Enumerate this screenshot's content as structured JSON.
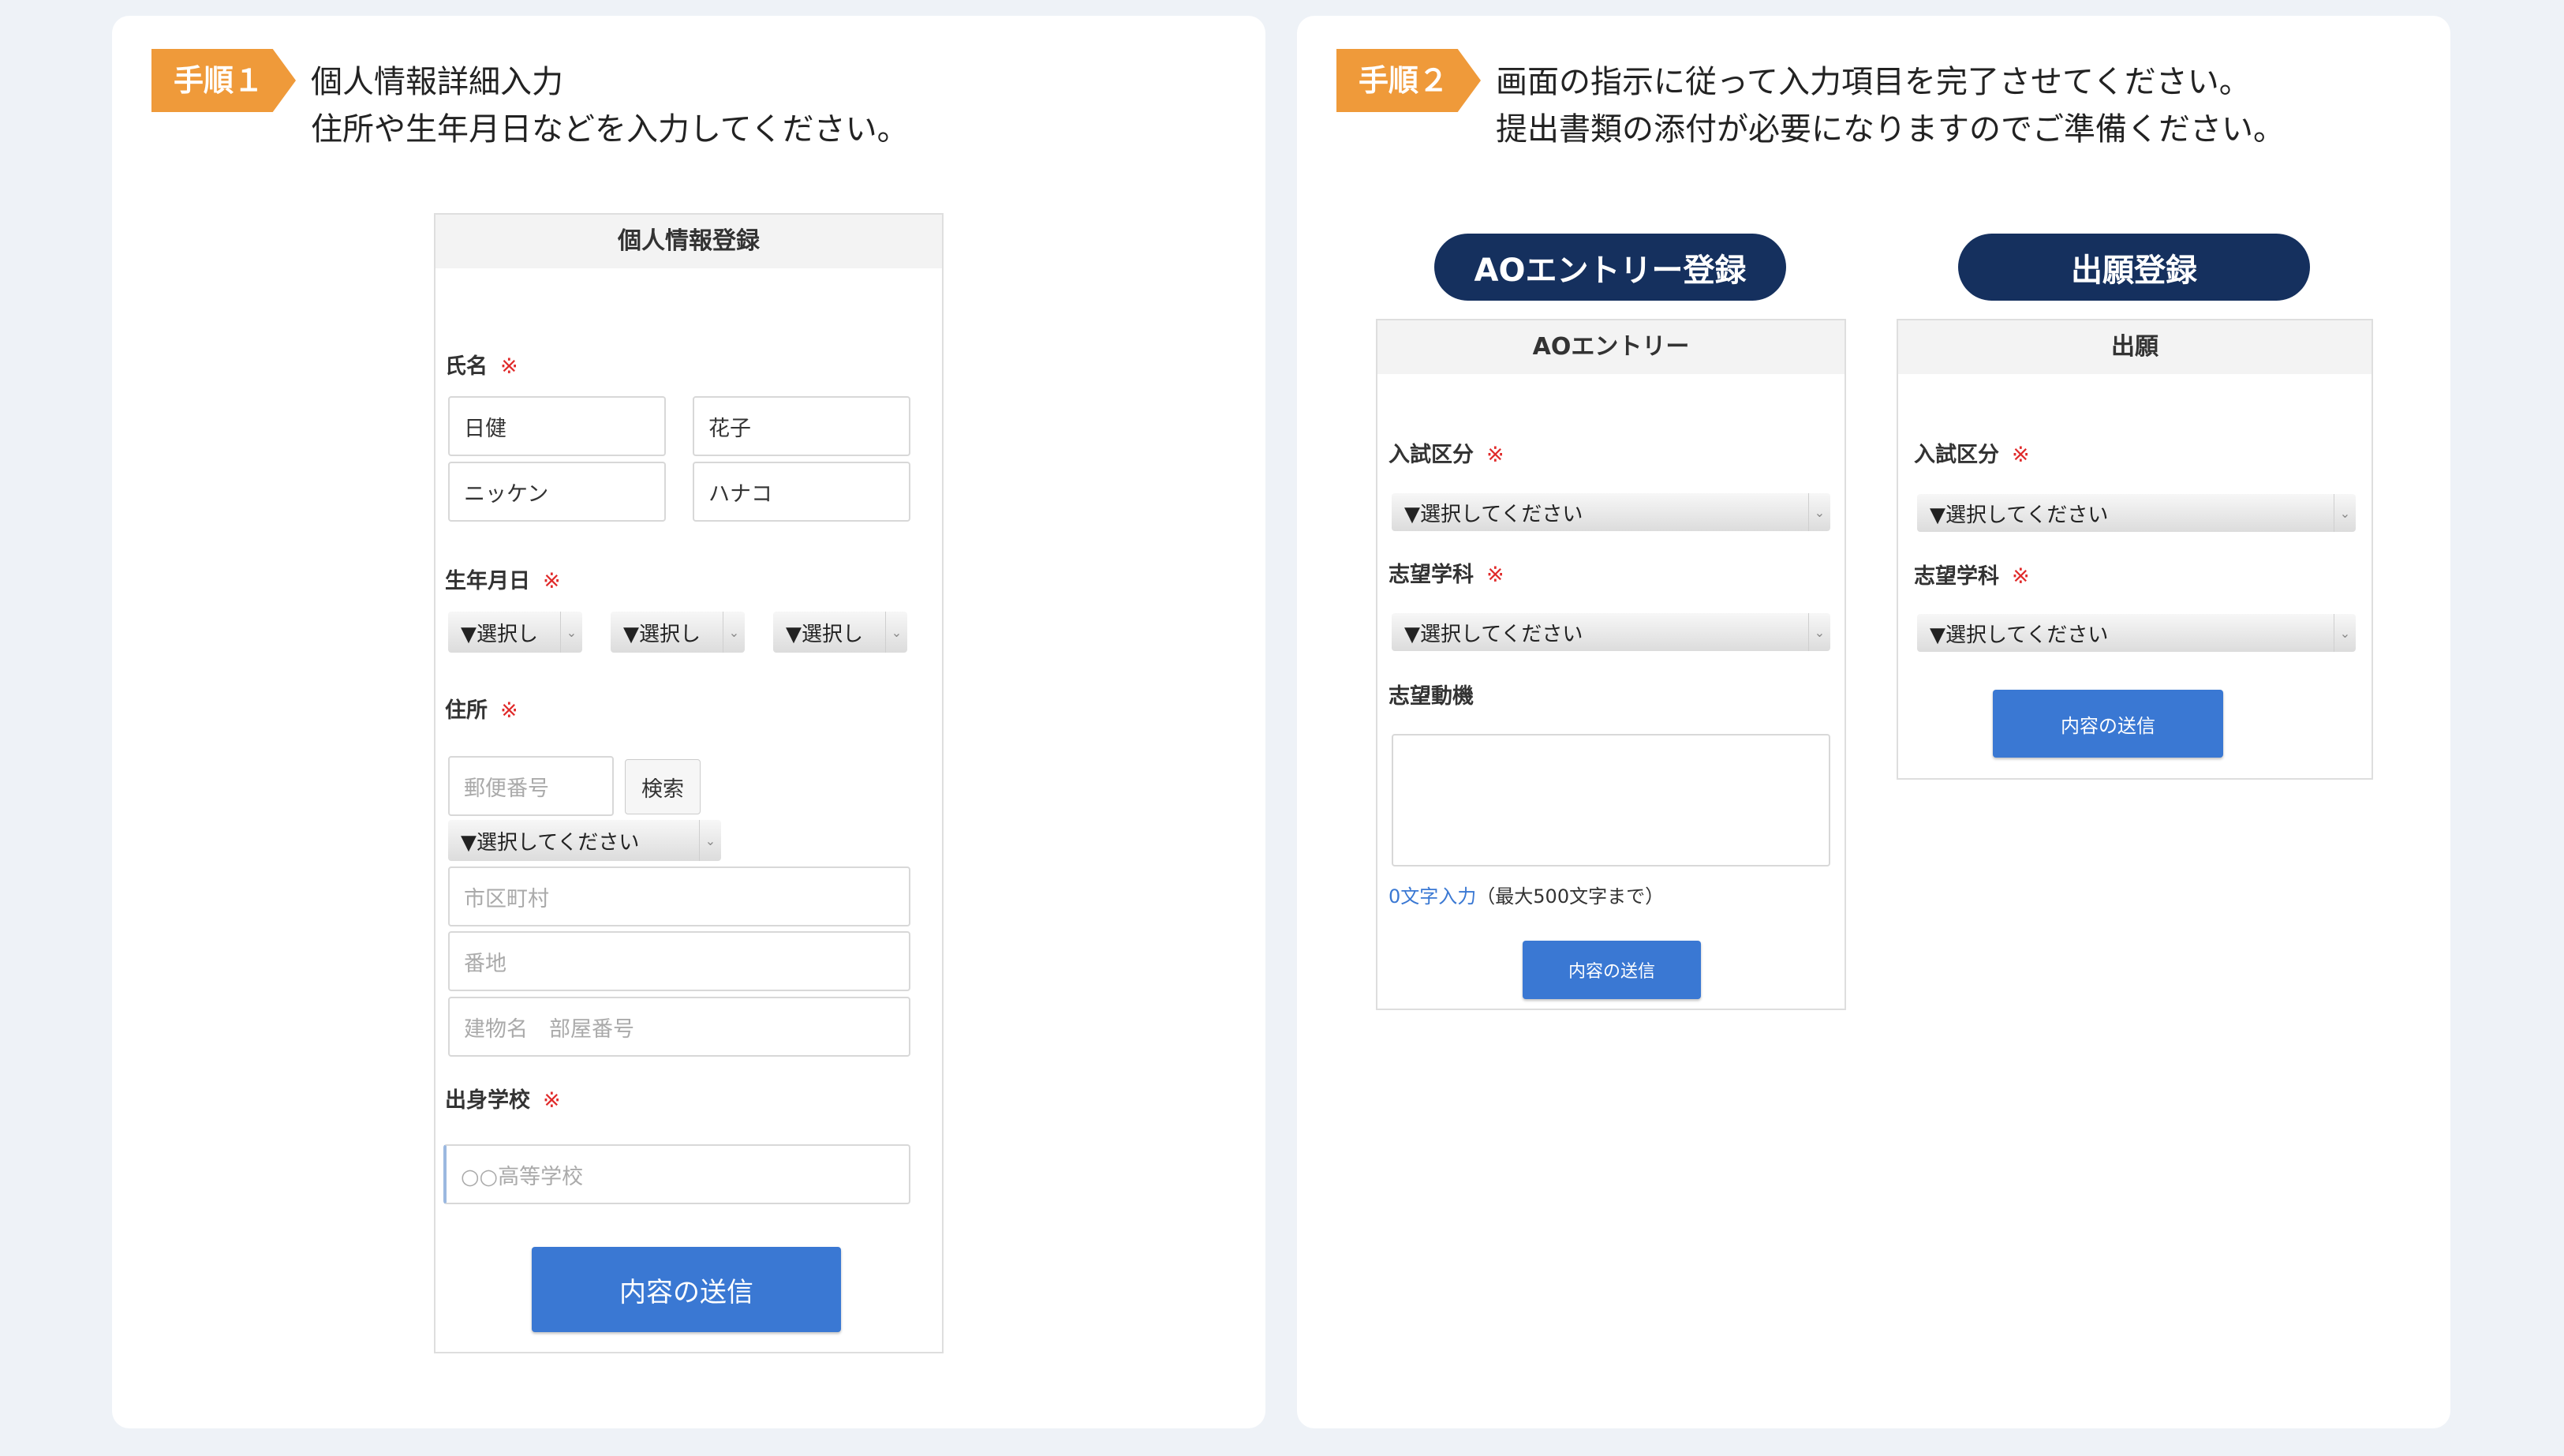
{
  "step1": {
    "badge": "手順１",
    "line1": "個人情報詳細入力",
    "line2": "住所や生年月日などを入力してください。",
    "form": {
      "title": "個人情報登録",
      "name_label": "氏名",
      "required_mark": "※",
      "last_name": "日健",
      "first_name": "花子",
      "last_name_kana": "ニッケン",
      "first_name_kana": "ハナコ",
      "birth_label": "生年月日",
      "birth_selects": [
        "▼選択し",
        "▼選択し",
        "▼選択し"
      ],
      "address_label": "住所",
      "postal_placeholder": "郵便番号",
      "search_button": "検索",
      "prefecture_select": "▼選択してください",
      "city_placeholder": "市区町村",
      "street_placeholder": "番地",
      "building_placeholder": "建物名　部屋番号",
      "school_label": "出身学校",
      "school_placeholder": "○○高等学校",
      "submit": "内容の送信"
    }
  },
  "step2": {
    "badge": "手順２",
    "line1": "画面の指示に従って入力項目を完了させてください。",
    "line2": "提出書類の添付が必要になりますのでご準備ください。",
    "ao": {
      "pill": "AOエントリー登録",
      "title": "AOエントリー",
      "exam_label": "入試区分",
      "required_mark": "※",
      "exam_select": "▼選択してください",
      "dept_label": "志望学科",
      "dept_select": "▼選択してください",
      "motive_label": "志望動機",
      "char_count": "0文字入力",
      "char_limit": "（最大500文字まで）",
      "submit": "内容の送信"
    },
    "apply": {
      "pill": "出願登録",
      "title": "出願",
      "exam_label": "入試区分",
      "required_mark": "※",
      "exam_select": "▼選択してください",
      "dept_label": "志望学科",
      "dept_select": "▼選択してください",
      "submit": "内容の送信"
    }
  },
  "colors": {
    "badge": "#ef9a3a",
    "pill": "#15305e",
    "submit": "#3a78d3",
    "required": "#e02a2a",
    "background": "#eef2f7"
  }
}
